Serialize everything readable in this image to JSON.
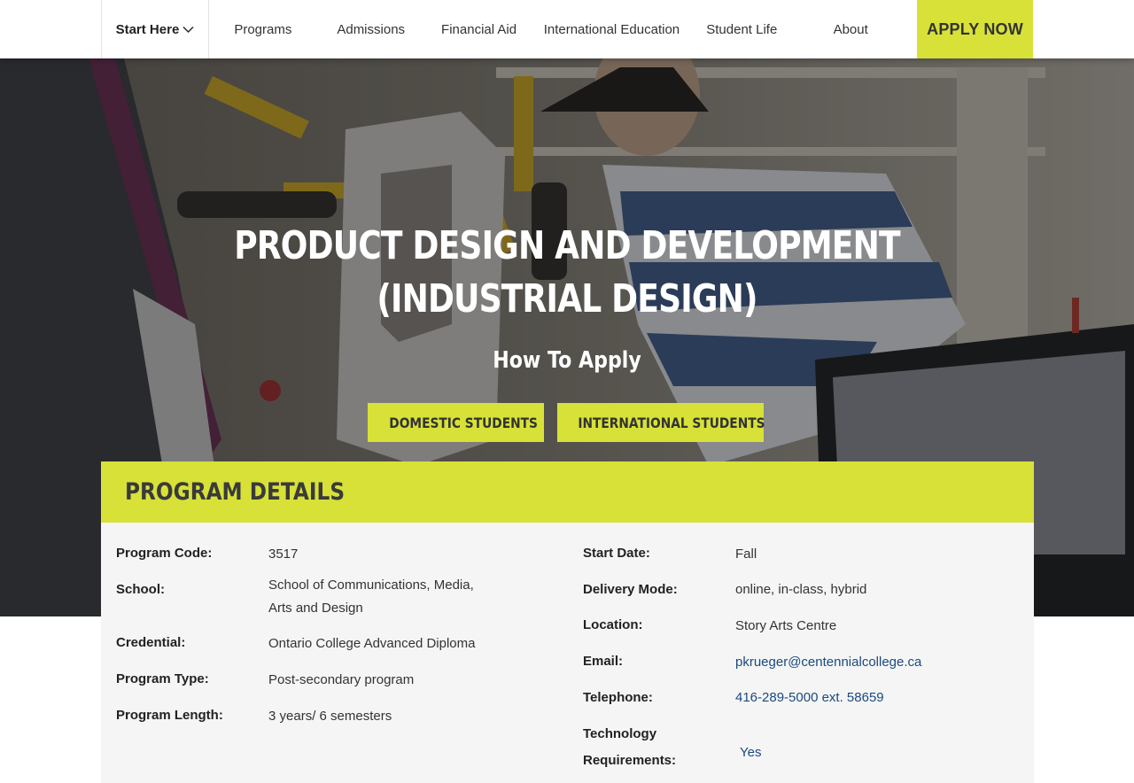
{
  "nav": {
    "start_here": "Start Here",
    "items": [
      "Programs",
      "Admissions",
      "Financial Aid",
      "International Education",
      "Student Life",
      "About"
    ],
    "apply_now": "APPLY NOW",
    "accent_color": "#d7e138"
  },
  "hero": {
    "title": "PRODUCT DESIGN AND DEVELOPMENT (INDUSTRIAL DESIGN)",
    "subtitle": "How To Apply",
    "buttons": {
      "domestic": "DOMESTIC STUDENTS",
      "international": "INTERNATIONAL STUDENTS"
    }
  },
  "details": {
    "heading": "PROGRAM DETAILS",
    "left": [
      {
        "label": "Program Code:",
        "value": "3517"
      },
      {
        "label": "School:",
        "value": "School of Communications, Media, Arts and Design"
      },
      {
        "label": "Credential:",
        "value": "Ontario College Advanced Diploma"
      },
      {
        "label": "Program Type:",
        "value": "Post-secondary program"
      },
      {
        "label": "Program Length:",
        "value": "3 years/ 6 semesters"
      }
    ],
    "right": [
      {
        "label": "Start Date:",
        "value": "Fall"
      },
      {
        "label": "Delivery Mode:",
        "value": "online, in-class, hybrid"
      },
      {
        "label": "Location:",
        "value": "Story Arts Centre"
      },
      {
        "label": "Email:",
        "value": "pkrueger@centennialcollege.ca"
      },
      {
        "label": "Telephone:",
        "value": "416-289-5000 ext. 58659"
      },
      {
        "label": "Technology Requirements:",
        "value": "Yes"
      }
    ]
  }
}
